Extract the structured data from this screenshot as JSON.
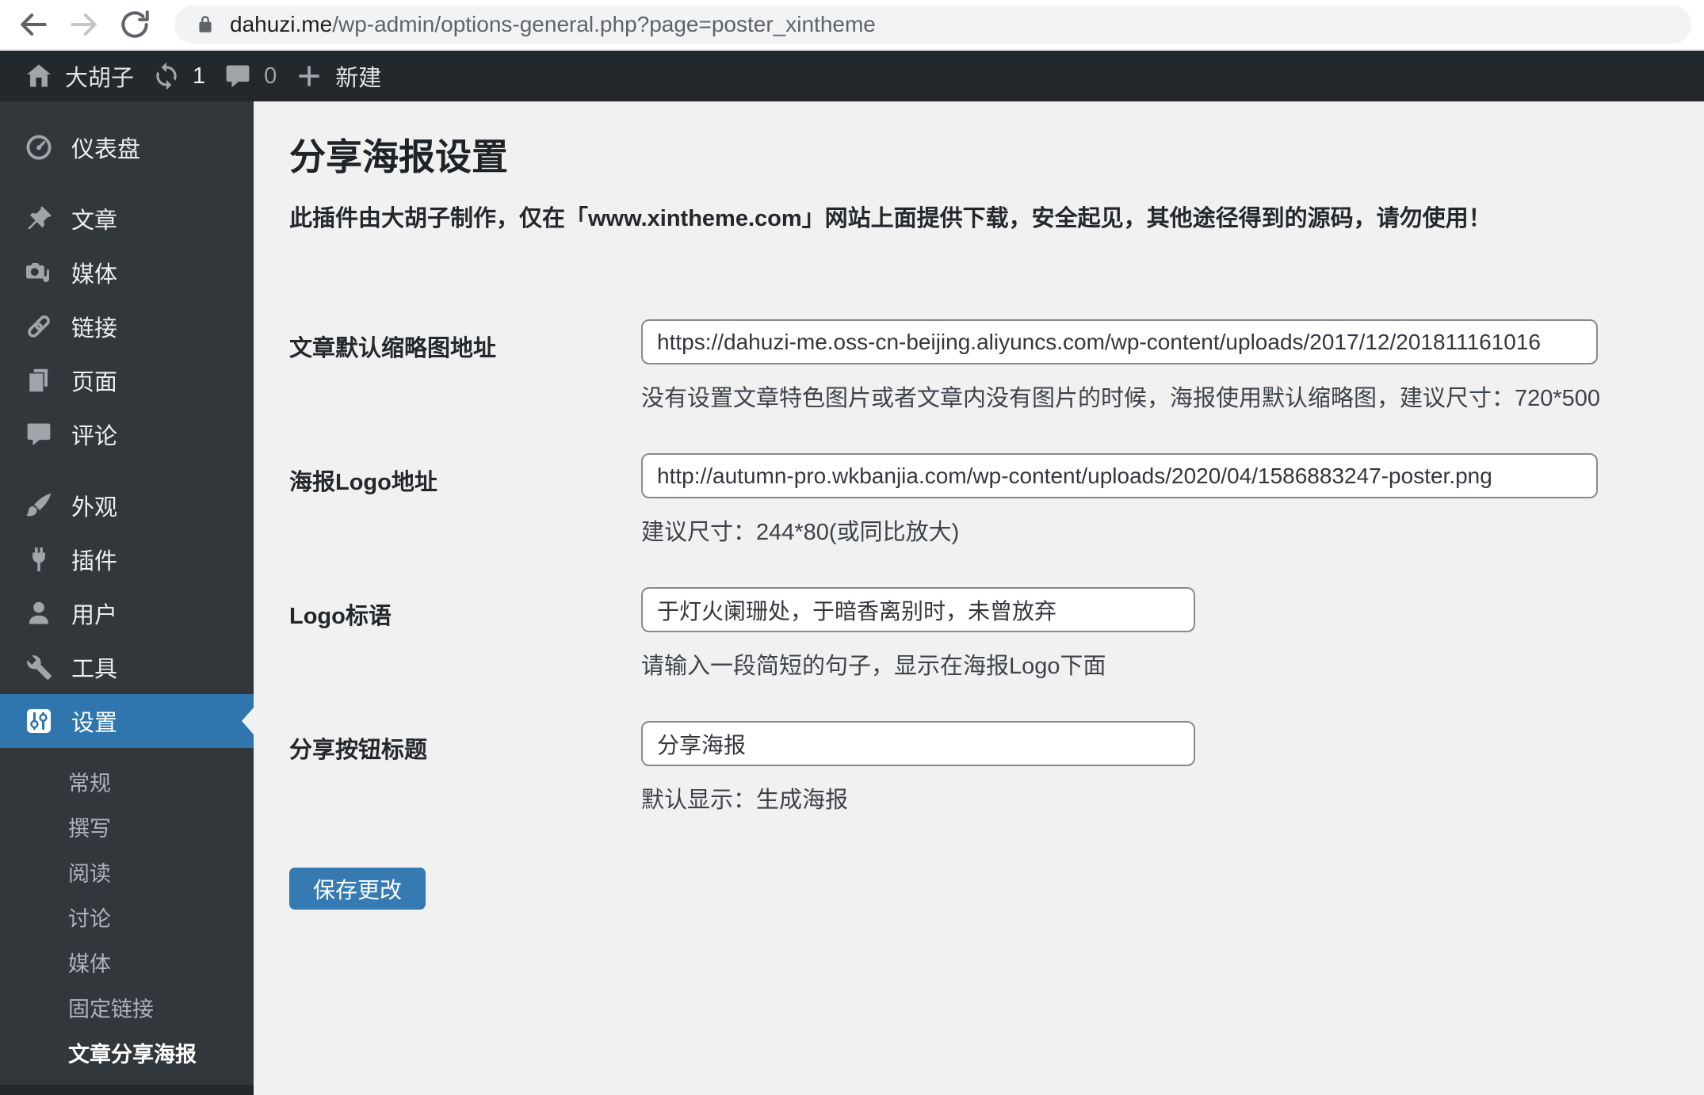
{
  "browser": {
    "url_domain": "dahuzi.me",
    "url_path": "/wp-admin/options-general.php?page=poster_xintheme"
  },
  "admin_bar": {
    "site_name": "大胡子",
    "update_count": "1",
    "comment_count": "0",
    "new_label": "新建"
  },
  "sidebar": {
    "items": [
      {
        "label": "仪表盘",
        "icon": "dashboard-icon"
      },
      {
        "label": "文章",
        "icon": "posts-pin-icon"
      },
      {
        "label": "媒体",
        "icon": "media-icon"
      },
      {
        "label": "链接",
        "icon": "links-chain-icon"
      },
      {
        "label": "页面",
        "icon": "pages-icon"
      },
      {
        "label": "评论",
        "icon": "comments-icon"
      },
      {
        "label": "外观",
        "icon": "appearance-brush-icon"
      },
      {
        "label": "插件",
        "icon": "plugins-plug-icon"
      },
      {
        "label": "用户",
        "icon": "users-icon"
      },
      {
        "label": "工具",
        "icon": "tools-wrench-icon"
      },
      {
        "label": "设置",
        "icon": "settings-sliders-icon",
        "selected": true
      }
    ],
    "submenu": [
      {
        "label": "常规"
      },
      {
        "label": "撰写"
      },
      {
        "label": "阅读"
      },
      {
        "label": "讨论"
      },
      {
        "label": "媒体"
      },
      {
        "label": "固定链接"
      },
      {
        "label": "文章分享海报",
        "current": true
      }
    ]
  },
  "main": {
    "title": "分享海报设置",
    "notice": "此插件由大胡子制作，仅在「www.xintheme.com」网站上面提供下载，安全起见，其他途径得到的源码，请勿使用！",
    "fields": [
      {
        "label": "文章默认缩略图地址",
        "value": "https://dahuzi-me.oss-cn-beijing.aliyuncs.com/wp-content/uploads/2017/12/201811161016",
        "help": "没有设置文章特色图片或者文章内没有图片的时候，海报使用默认缩略图，建议尺寸：720*500"
      },
      {
        "label": "海报Logo地址",
        "value": "http://autumn-pro.wkbanjia.com/wp-content/uploads/2020/04/1586883247-poster.png",
        "help": "建议尺寸：244*80(或同比放大)"
      },
      {
        "label": "Logo标语",
        "value": "于灯火阑珊处，于暗香离别时，未曾放弃",
        "help": "请输入一段简短的句子，显示在海报Logo下面"
      },
      {
        "label": "分享按钮标题",
        "value": "分享海报",
        "help": "默认显示：生成海报"
      }
    ],
    "save_label": "保存更改"
  },
  "colors": {
    "admin_bar_bg": "#23282d",
    "sidebar_bg": "#32373c",
    "selected_menu_blue": "#2e76ad",
    "button_blue": "#357ab2",
    "content_bg": "#f1f1f1",
    "input_border": "#868b90"
  }
}
